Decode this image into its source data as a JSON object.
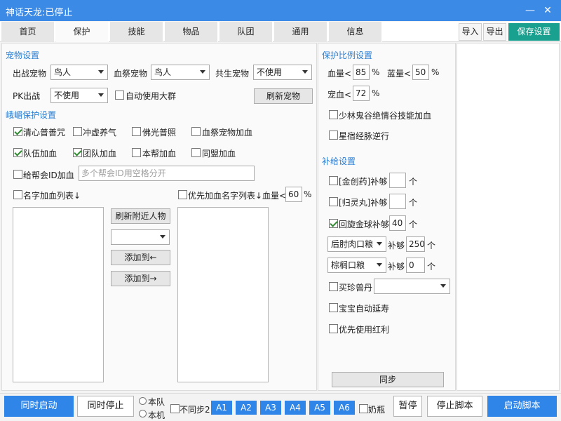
{
  "window": {
    "title": "神话天龙:已停止",
    "minimize": "—",
    "close": "✕"
  },
  "tabs": [
    "首页",
    "保护",
    "技能",
    "物品",
    "队团",
    "通用",
    "信息"
  ],
  "toolbar": {
    "import": "导入",
    "export": "导出",
    "save": "保存设置"
  },
  "pet": {
    "section": "宠物设置",
    "battle_label": "出战宠物",
    "battle_value": "鸟人",
    "sacrifice_label": "血祭宠物",
    "sacrifice_value": "鸟人",
    "share_label": "共生宠物",
    "share_value": "不使用",
    "pk_label": "PK出战",
    "pk_value": "不使用",
    "auto_group": "自动使用大群",
    "refresh": "刷新宠物"
  },
  "emei": {
    "section": "峨嵋保护设置",
    "checks": [
      {
        "label": "清心普善咒",
        "checked": true
      },
      {
        "label": "冲虚养气",
        "checked": false
      },
      {
        "label": "佛光普照",
        "checked": false
      },
      {
        "label": "血祭宠物加血",
        "checked": false
      },
      {
        "label": "队伍加血",
        "checked": true
      },
      {
        "label": "团队加血",
        "checked": true
      },
      {
        "label": "本帮加血",
        "checked": false
      },
      {
        "label": "同盟加血",
        "checked": false
      }
    ],
    "guild_id_label": "给帮会ID加血",
    "guild_id_placeholder": "多个帮会ID用空格分开",
    "name_list_label": "名字加血列表↓",
    "priority_label": "优先加血名字列表↓",
    "hp_label": "血量<",
    "hp_value": "60",
    "hp_unit": "%",
    "refresh_nearby": "刷新附近人物",
    "add_left": "添加到←",
    "add_right": "添加到→"
  },
  "ratio": {
    "section": "保护比例设置",
    "hp_label": "血量<",
    "hp_value": "85",
    "hp_unit": "%",
    "mp_label": "蓝量<",
    "mp_value": "50",
    "mp_unit": "%",
    "pet_hp_label": "宠血<",
    "pet_hp_value": "72",
    "pet_hp_unit": "%",
    "shaolin": "少林鬼谷绝情谷技能加血",
    "xingsu": "星宿经脉逆行"
  },
  "supply": {
    "section": "补给设置",
    "items": [
      {
        "label": "[金创药]补够",
        "value": "",
        "unit": "个",
        "checked": false
      },
      {
        "label": "[归灵丸]补够",
        "value": "",
        "unit": "个",
        "checked": false
      },
      {
        "label": "回旋金球补够",
        "value": "40",
        "unit": "个",
        "checked": true
      }
    ],
    "food1_value": "后肘肉口粮",
    "food1_label": "补够",
    "food1_count": "250",
    "food1_unit": "个",
    "food2_value": "棕榈口粮",
    "food2_label": "补够",
    "food2_count": "0",
    "food2_unit": "个",
    "buy_label": "买珍兽丹",
    "baby_label": "宝宝自动延寿",
    "red_label": "优先使用红利",
    "sync": "同步"
  },
  "bottom": {
    "start_all": "同时启动",
    "stop_all": "同时停止",
    "radio_team": "本队",
    "radio_local": "本机",
    "nosync": "不同步2",
    "accounts": [
      "A1",
      "A2",
      "A3",
      "A4",
      "A5",
      "A6"
    ],
    "milk": "奶瓶",
    "pause": "暂停",
    "stop_script": "停止脚本",
    "start_script": "启动脚本"
  }
}
